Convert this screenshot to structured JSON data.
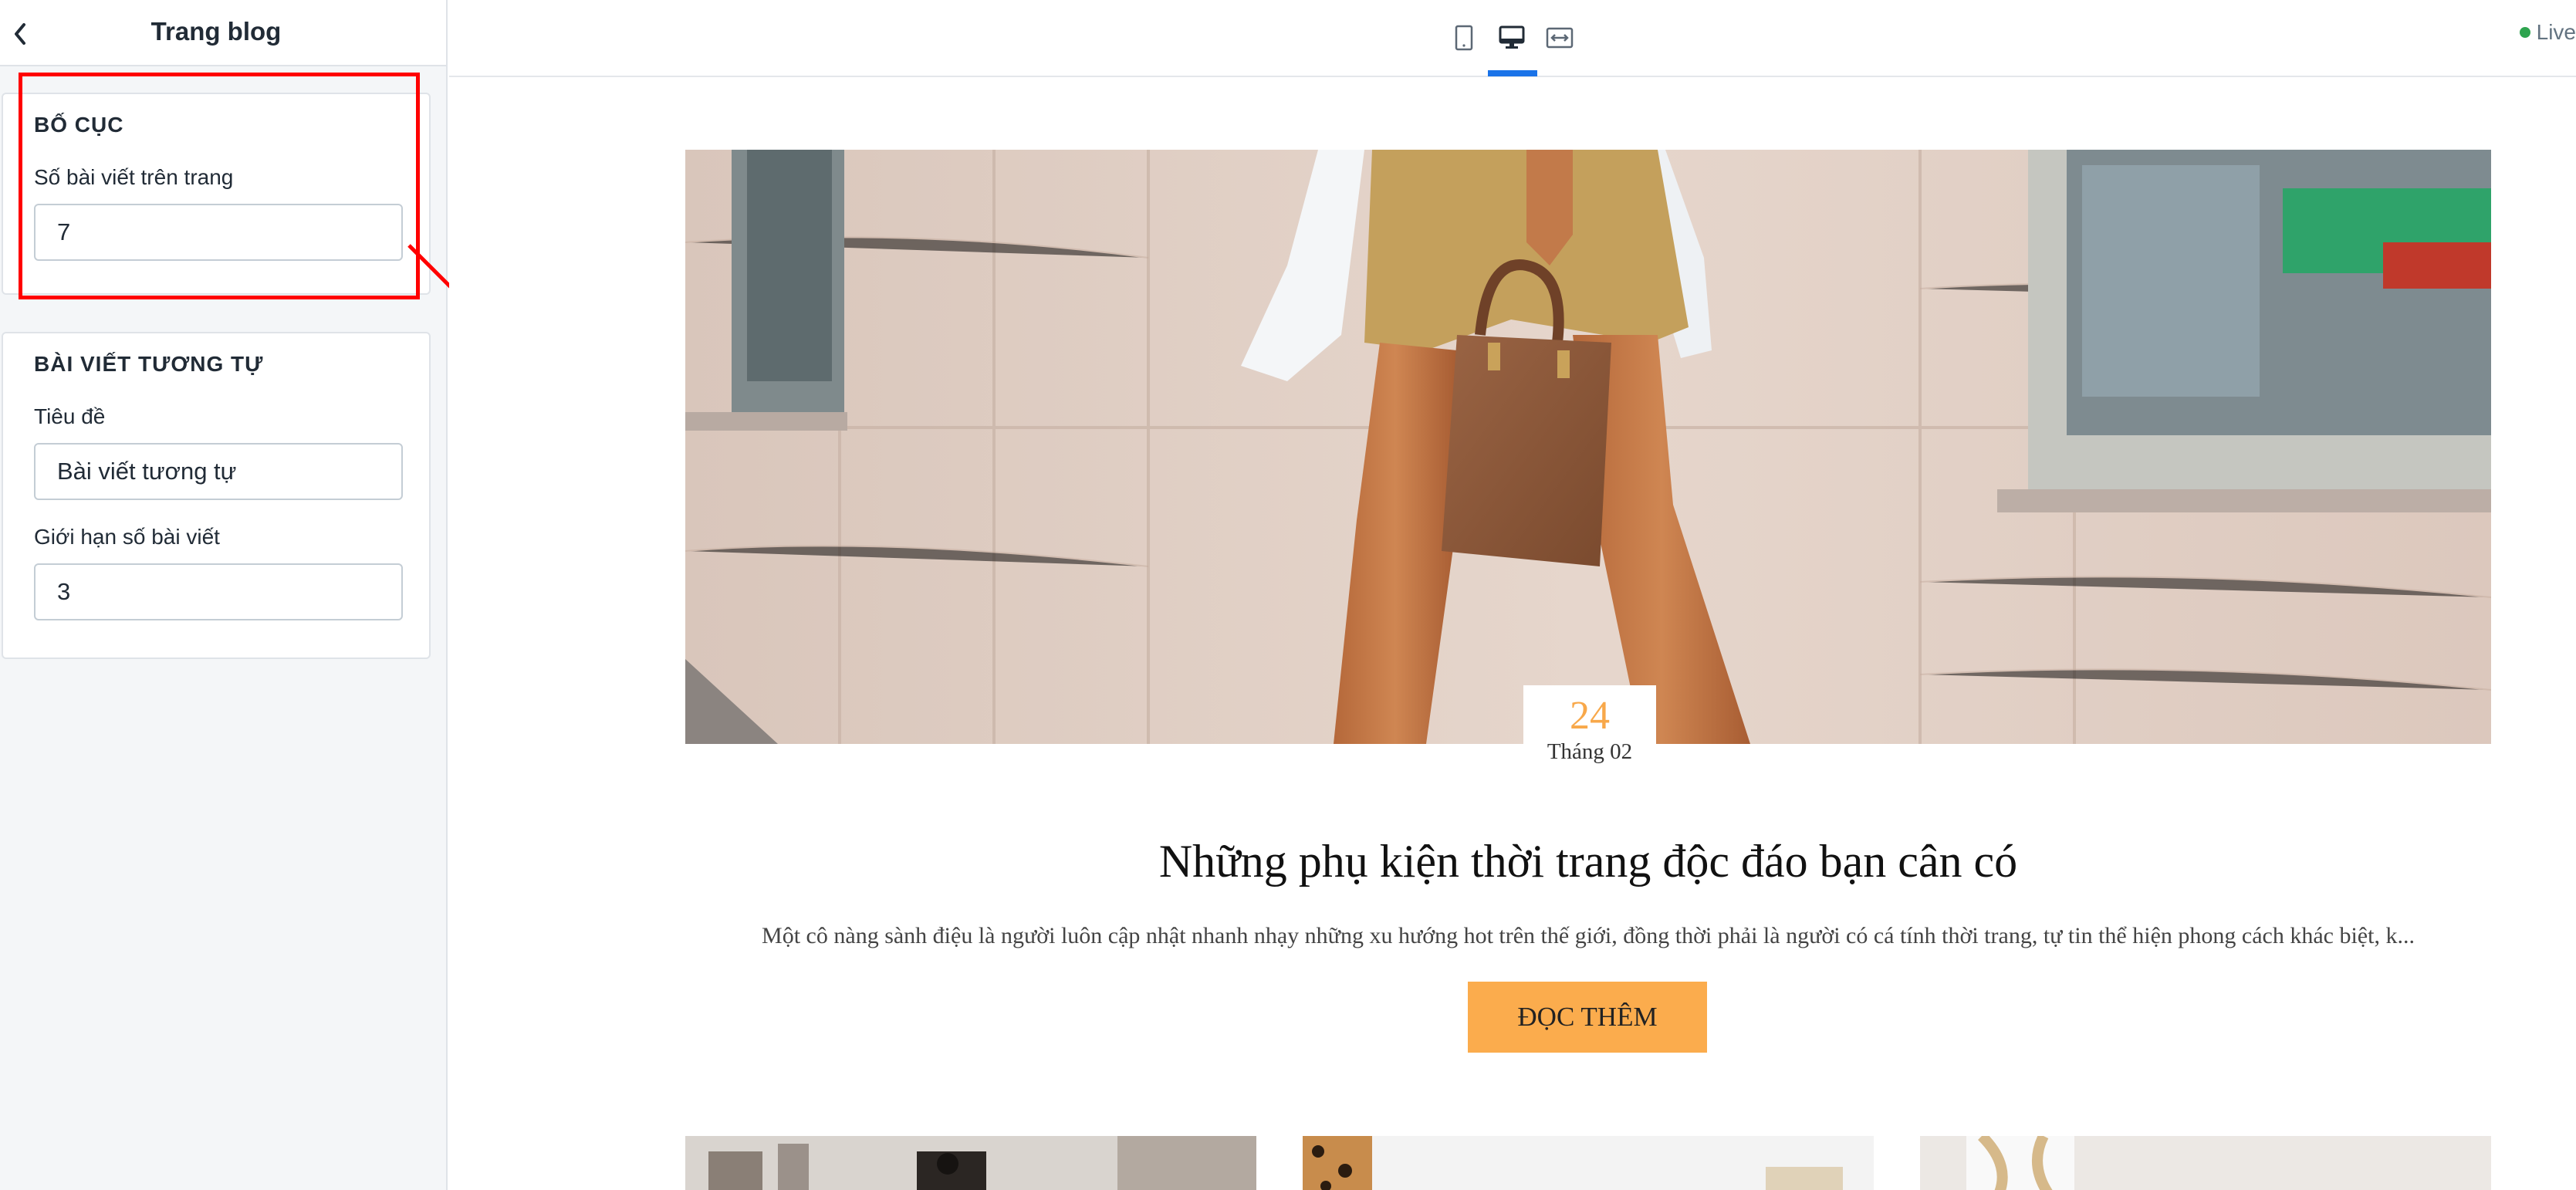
{
  "sidebar": {
    "title": "Trang blog",
    "sections": [
      {
        "title": "BỐ CỤC",
        "fields": [
          {
            "label": "Số bài viết trên trang",
            "value": "7"
          }
        ]
      },
      {
        "title": "BÀI VIẾT TƯƠNG TỰ",
        "fields": [
          {
            "label": "Tiêu đề",
            "value": "Bài viết tương tự"
          },
          {
            "label": "Giới hạn số bài viết",
            "value": "3"
          }
        ]
      }
    ]
  },
  "toolbar": {
    "device_icons": [
      "mobile-icon",
      "desktop-icon",
      "full-width-icon"
    ],
    "active_device": "desktop",
    "live_label": "Live"
  },
  "annotation": {
    "color": "#ff0000"
  },
  "preview": {
    "post": {
      "date_day": "24",
      "date_month": "Tháng 02",
      "title": "Những phụ kiện thời trang độc đáo bạn cân có",
      "excerpt": "Một cô nàng sành điệu là người luôn cập nhật nhanh nhạy những xu hướng hot trên thế giới, đồng thời phải là người có cá tính thời trang, tự tin thể hiện phong cách khác biệt, k...",
      "button_label": "ĐỌC THÊM"
    },
    "accent_color": "#fbac4d"
  }
}
